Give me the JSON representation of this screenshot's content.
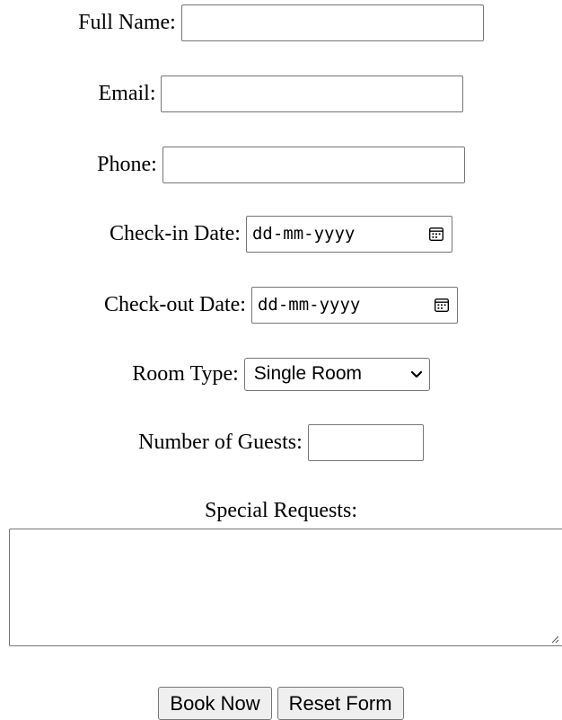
{
  "form": {
    "full_name": {
      "label": "Full Name:",
      "value": ""
    },
    "email": {
      "label": "Email:",
      "value": ""
    },
    "phone": {
      "label": "Phone:",
      "value": ""
    },
    "checkin": {
      "label": "Check-in Date:",
      "placeholder": "dd-mm-yyyy",
      "icon": "calendar-icon"
    },
    "checkout": {
      "label": "Check-out Date:",
      "placeholder": "dd-mm-yyyy",
      "icon": "calendar-icon"
    },
    "room_type": {
      "label": "Room Type:",
      "selected": "Single Room",
      "icon": "chevron-down-icon"
    },
    "guests": {
      "label": "Number of Guests:",
      "value": ""
    },
    "special_requests": {
      "label": "Special Requests:",
      "value": ""
    },
    "buttons": {
      "book": "Book Now",
      "reset": "Reset Form"
    }
  },
  "colors": {
    "border": "#767676",
    "button_bg": "#efefef",
    "text": "#000000",
    "background": "#ffffff"
  }
}
